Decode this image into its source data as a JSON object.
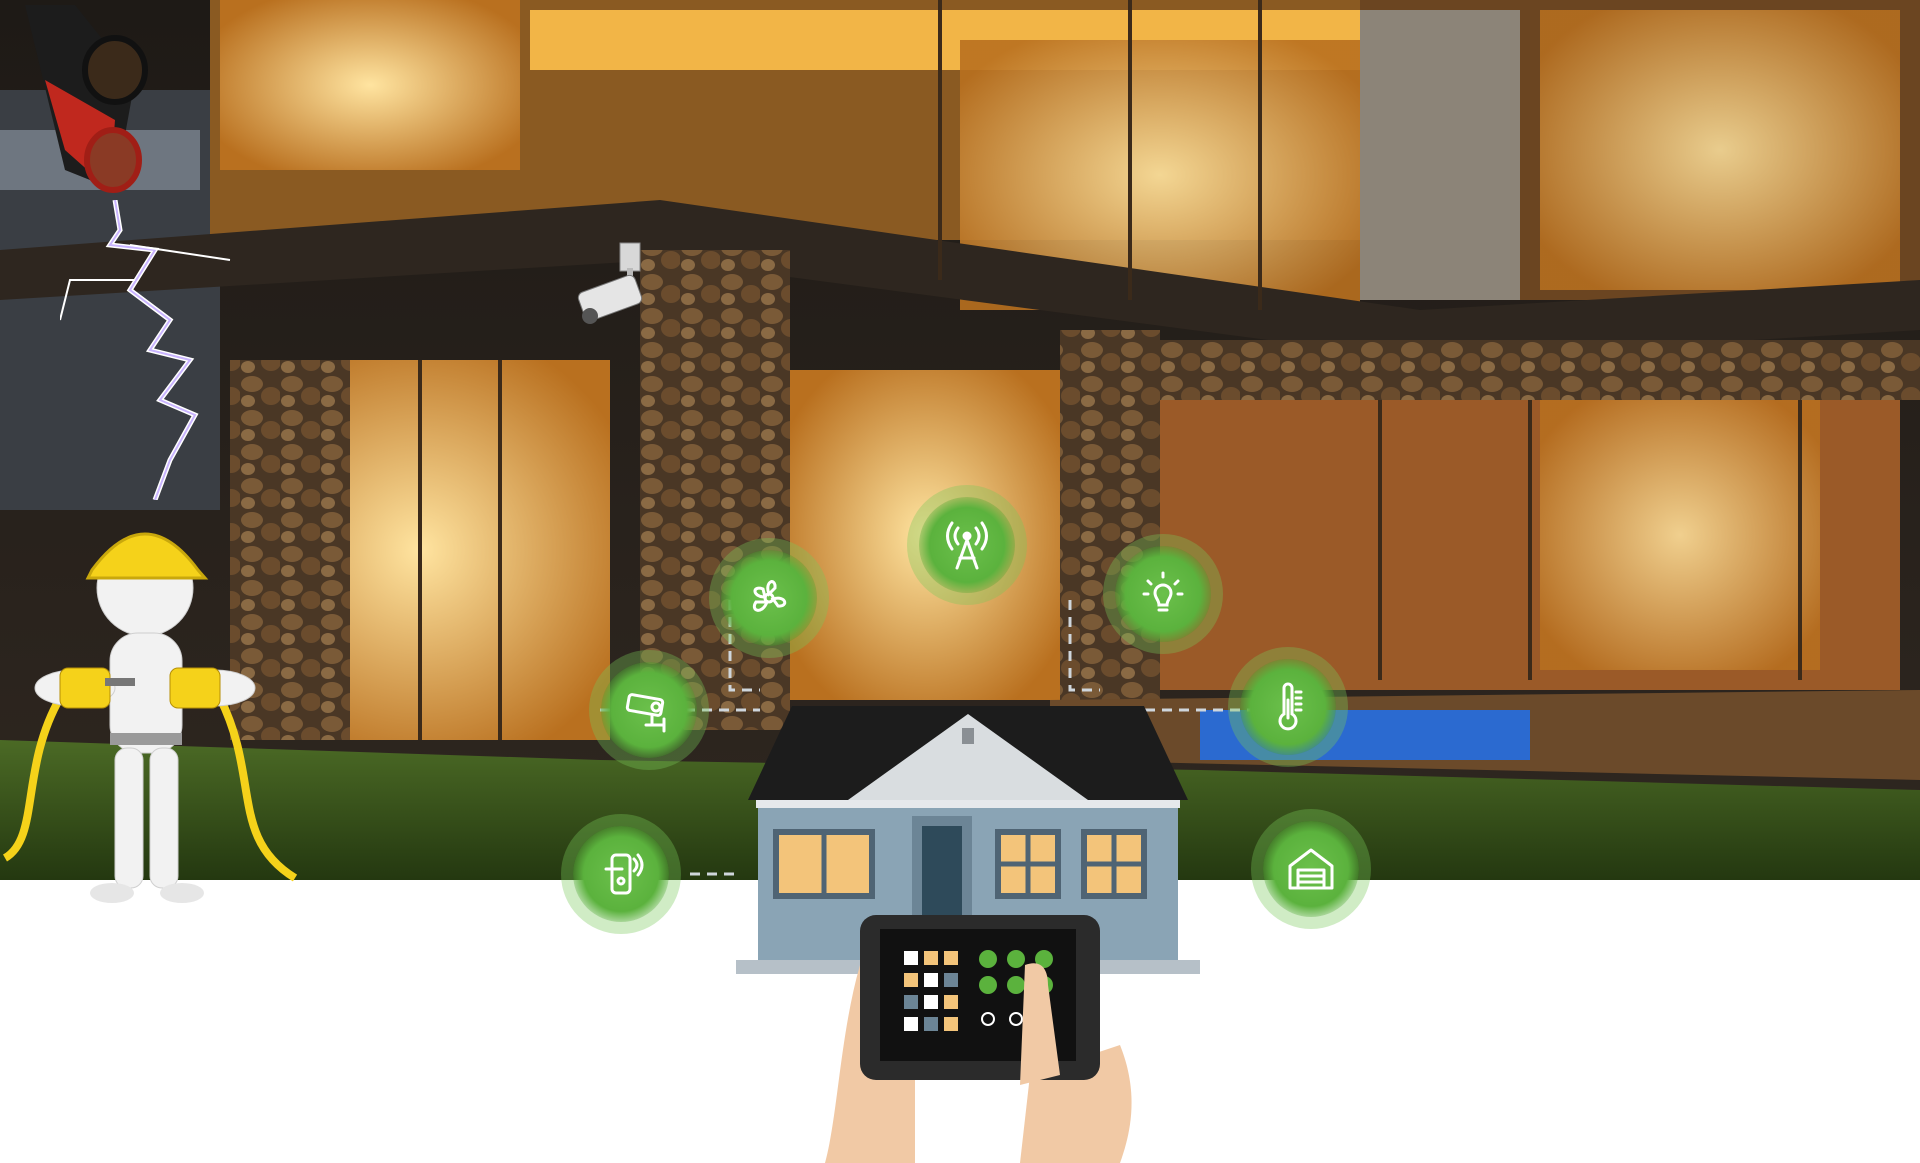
{
  "scene": {
    "description_free": true,
    "colors": {
      "night_sky": "#2a2118",
      "warm_light": "#f7b545",
      "stone": "#5a4632",
      "lawn": "#3b5a1c",
      "icon_green": "#5bb23d",
      "house_body": "#8aa4b5",
      "roof": "#1c1c1c",
      "window": "#f3c47a",
      "hand": "#f1c9a5",
      "tablet": "#2b2b2b",
      "worker_body": "#f2f2f2",
      "helmet": "#f5d21a",
      "cable_yellow": "#f5d21a",
      "cable_red": "#c0281e"
    }
  },
  "smart_icons": [
    {
      "name": "antenna-icon"
    },
    {
      "name": "fan-icon"
    },
    {
      "name": "bulb-icon"
    },
    {
      "name": "camera-icon"
    },
    {
      "name": "thermometer-icon"
    },
    {
      "name": "door-lock-icon"
    },
    {
      "name": "garage-icon"
    }
  ]
}
